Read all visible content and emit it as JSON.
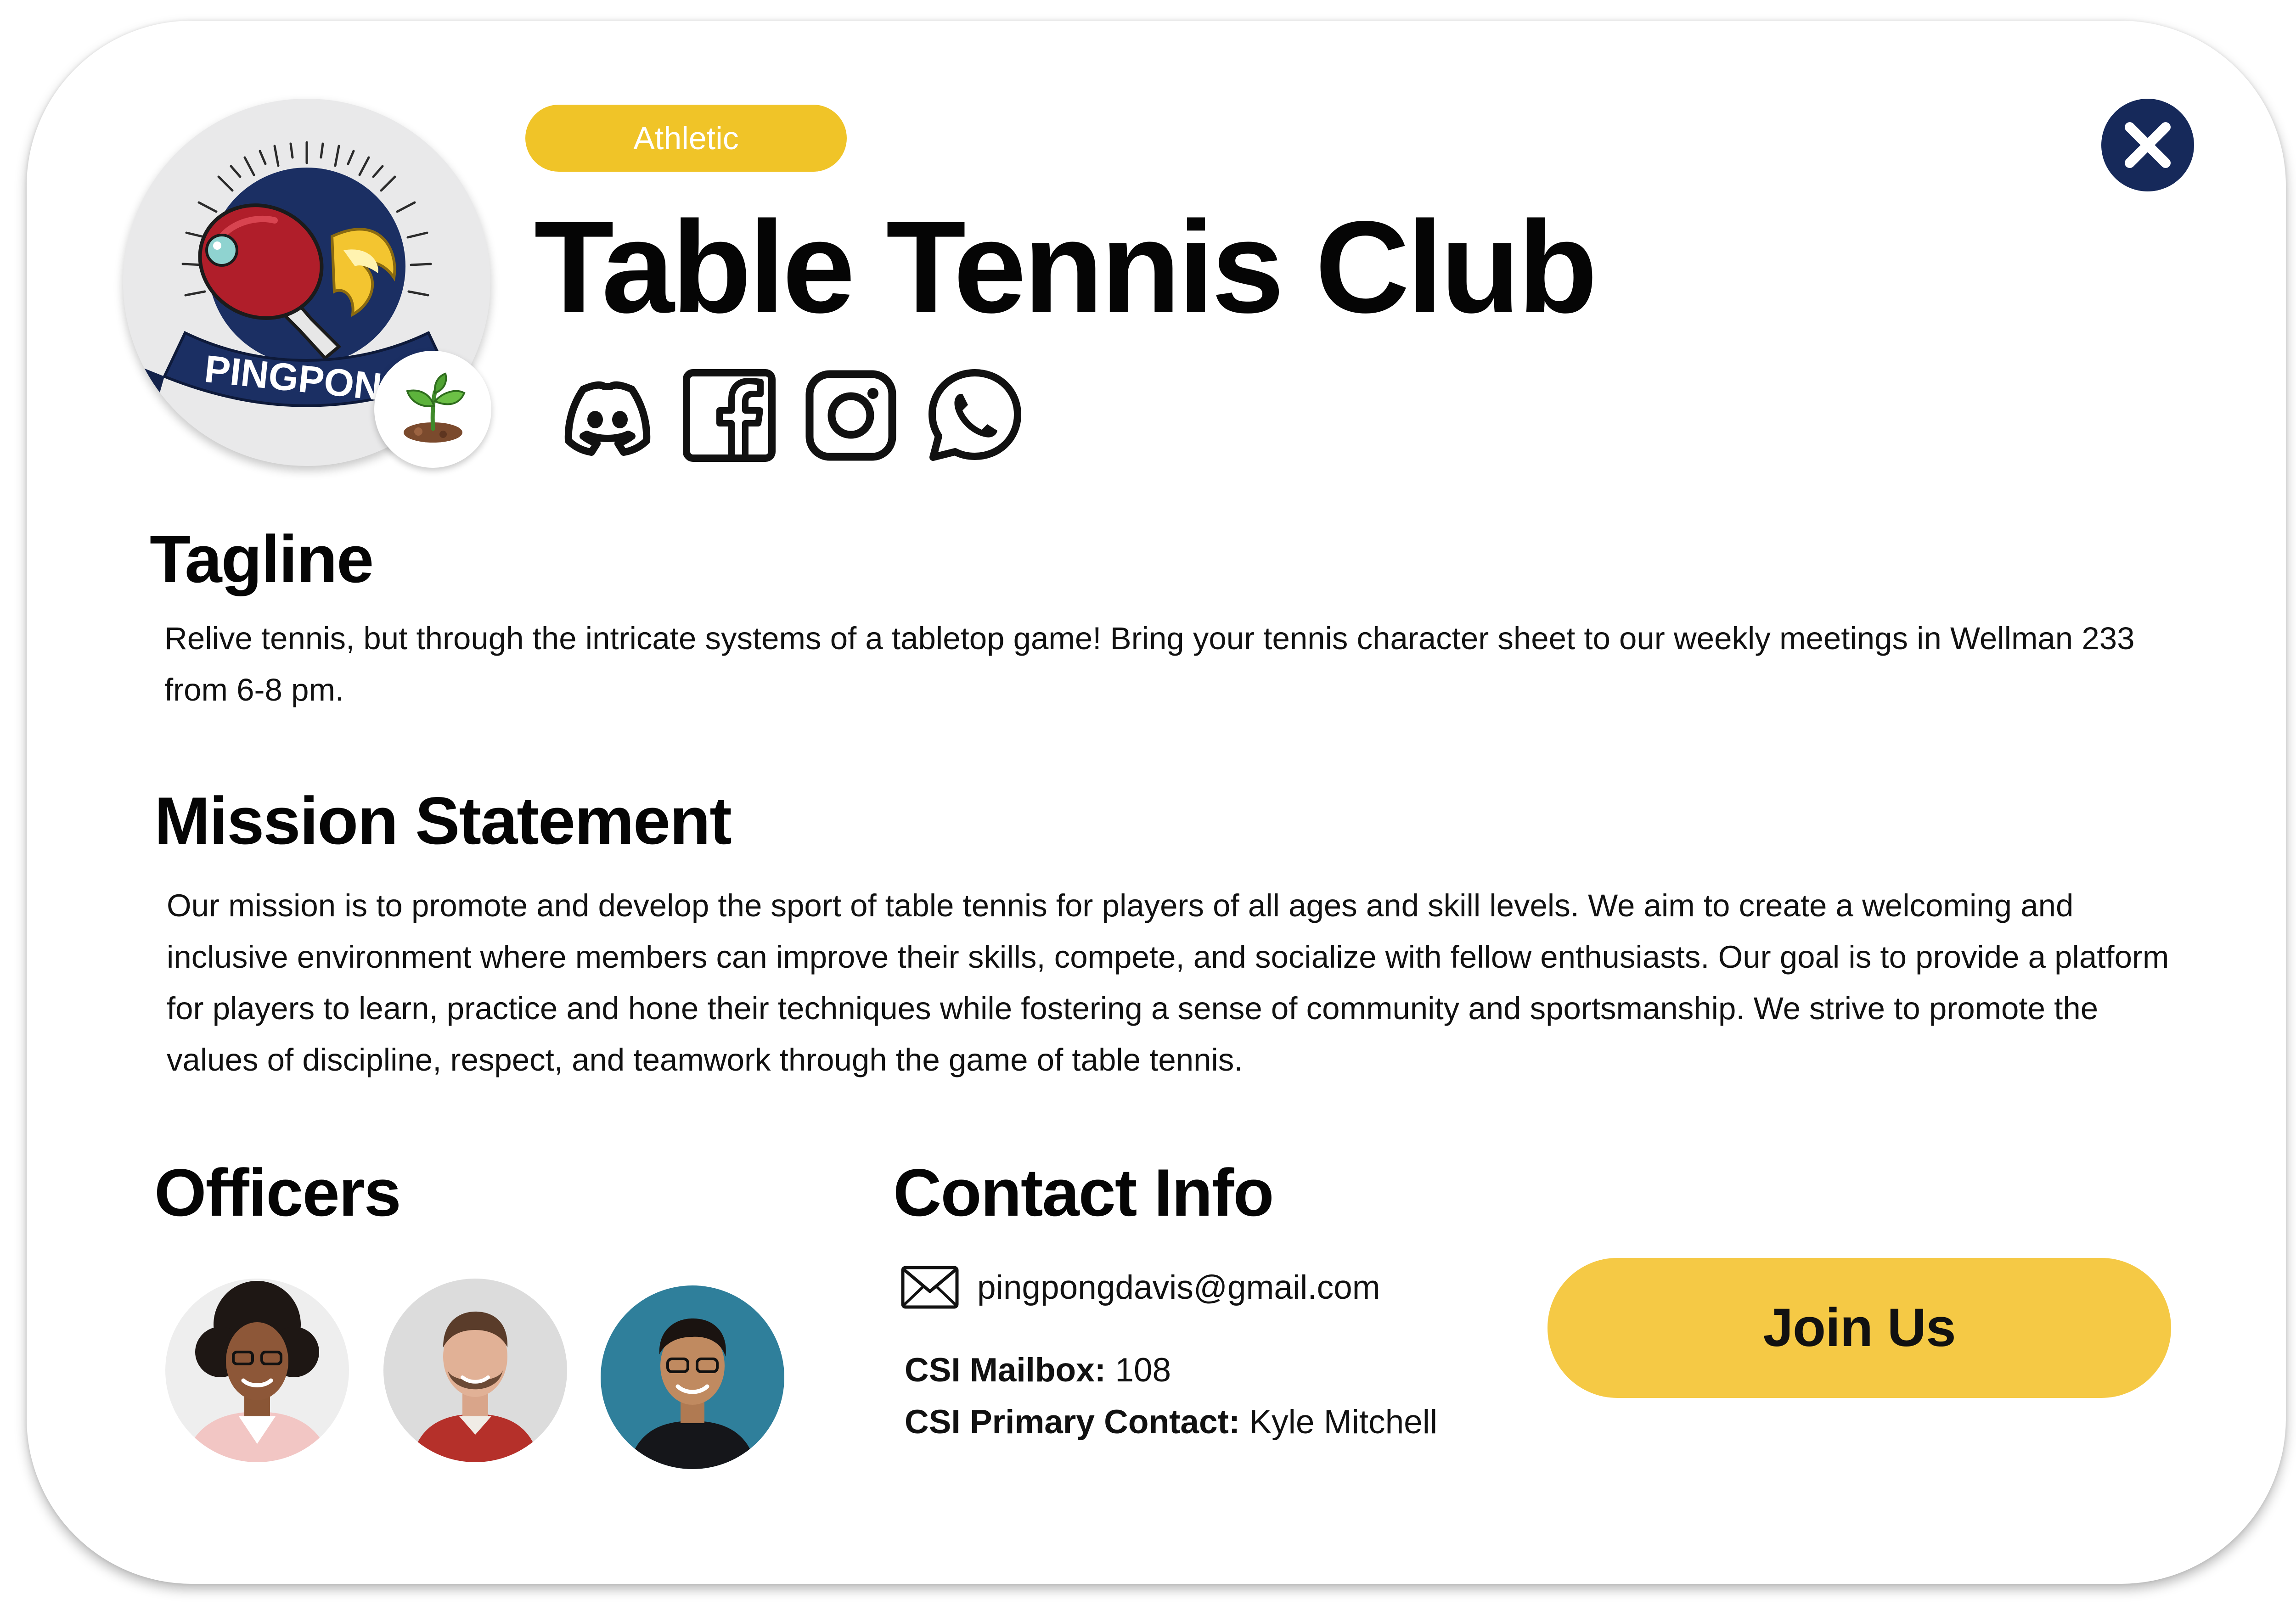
{
  "club": {
    "category": "Athletic",
    "name": "Table Tennis Club",
    "logo_text": "PINGPONG"
  },
  "socials": [
    "discord-icon",
    "facebook-icon",
    "instagram-icon",
    "whatsapp-icon"
  ],
  "tagline": {
    "heading": "Tagline",
    "text": "Relive tennis, but through the intricate systems of a tabletop game! Bring your tennis character sheet to our weekly meetings in Wellman 233 from 6-8 pm."
  },
  "mission": {
    "heading": "Mission Statement",
    "text": "Our mission is to promote and develop the sport of table tennis for players of all ages and skill levels. We aim to create a welcoming and inclusive environment where members can improve their skills, compete, and socialize with fellow enthusiasts. Our goal is to provide a platform for players to learn, practice and hone their techniques while fostering a sense of community and sportsmanship. We strive to promote the values of discipline, respect, and teamwork through the game of table tennis."
  },
  "officers": {
    "heading": "Officers"
  },
  "contact": {
    "heading": "Contact Info",
    "email": "pingpongdavis@gmail.com",
    "mailbox_label": "CSI Mailbox:",
    "mailbox_value": "108",
    "primary_label": "CSI Primary Contact:",
    "primary_value": "Kyle Mitchell"
  },
  "actions": {
    "join_label": "Join Us"
  },
  "colors": {
    "category_pill": "#f0c428",
    "join_button": "#f5c945",
    "close_button": "#16295a",
    "logo_navy": "#1b2f63",
    "paddle_red": "#b01e2a"
  }
}
